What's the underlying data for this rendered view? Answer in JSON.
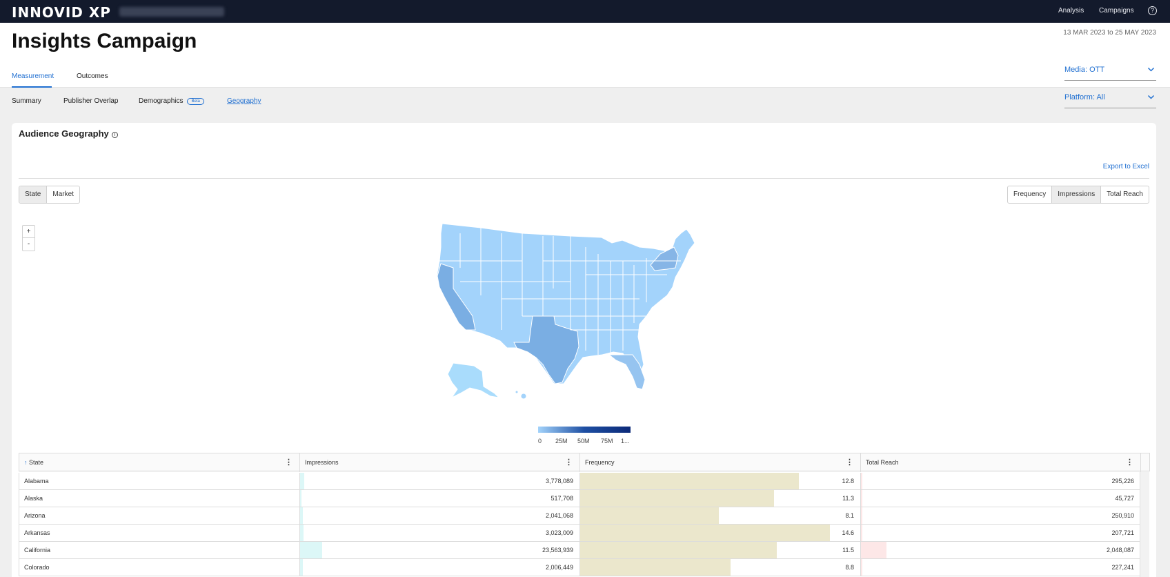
{
  "topbar": {
    "logo": "INNOVID XP",
    "nav": [
      {
        "label": "Analysis"
      },
      {
        "label": "Campaigns"
      }
    ],
    "help_icon": "help-circle-icon",
    "help_glyph": "?"
  },
  "header": {
    "title": "Insights Campaign",
    "date_range": "13 MAR 2023 to 25 MAY 2023"
  },
  "tabs": [
    {
      "label": "Measurement",
      "active": true
    },
    {
      "label": "Outcomes",
      "active": false
    }
  ],
  "filters": {
    "media": "Media:  OTT",
    "platform": "Platform:  All"
  },
  "subtabs": [
    {
      "label": "Summary"
    },
    {
      "label": "Publisher Overlap"
    },
    {
      "label": "Demographics",
      "badge": "Beta"
    },
    {
      "label": "Geography",
      "active": true
    }
  ],
  "card": {
    "title": "Audience Geography",
    "info_glyph": "i",
    "export_label": "Export to Excel",
    "geo_toggle": [
      {
        "label": "State",
        "selected": true
      },
      {
        "label": "Market",
        "selected": false
      }
    ],
    "metric_toggle": [
      {
        "label": "Frequency",
        "selected": false
      },
      {
        "label": "Impressions",
        "selected": true
      },
      {
        "label": "Total Reach",
        "selected": false
      }
    ],
    "zoom": {
      "in": "+",
      "out": "-"
    }
  },
  "map": {
    "legend_ticks": [
      "0",
      "25M",
      "50M",
      "75M",
      "1..."
    ],
    "colors": {
      "light": "#a3d3fb",
      "mid": "#86b5e6",
      "dark": "#7aaee3",
      "max": "#0c2a78"
    }
  },
  "table": {
    "columns": [
      {
        "label": "State",
        "sort_glyph": "↑"
      },
      {
        "label": "Impressions"
      },
      {
        "label": "Frequency"
      },
      {
        "label": "Total Reach"
      }
    ],
    "kebab": "⋮",
    "rows": [
      {
        "state": "Alabama",
        "impressions": "3,778,089",
        "impressions_frac": 0.016,
        "frequency": "12.8",
        "frequency_frac": 0.78,
        "reach": "295,226",
        "reach_frac": 0.004
      },
      {
        "state": "Alaska",
        "impressions": "517,708",
        "impressions_frac": 0.002,
        "frequency": "11.3",
        "frequency_frac": 0.69,
        "reach": "45,727",
        "reach_frac": 0.001
      },
      {
        "state": "Arizona",
        "impressions": "2,041,068",
        "impressions_frac": 0.009,
        "frequency": "8.1",
        "frequency_frac": 0.495,
        "reach": "250,910",
        "reach_frac": 0.004
      },
      {
        "state": "Arkansas",
        "impressions": "3,023,009",
        "impressions_frac": 0.013,
        "frequency": "14.6",
        "frequency_frac": 0.89,
        "reach": "207,721",
        "reach_frac": 0.003
      },
      {
        "state": "California",
        "impressions": "23,563,939",
        "impressions_frac": 0.078,
        "frequency": "11.5",
        "frequency_frac": 0.7,
        "reach": "2,048,087",
        "reach_frac": 0.09
      },
      {
        "state": "Colorado",
        "impressions": "2,006,449",
        "impressions_frac": 0.009,
        "frequency": "8.8",
        "frequency_frac": 0.535,
        "reach": "227,241",
        "reach_frac": 0.003
      }
    ]
  }
}
